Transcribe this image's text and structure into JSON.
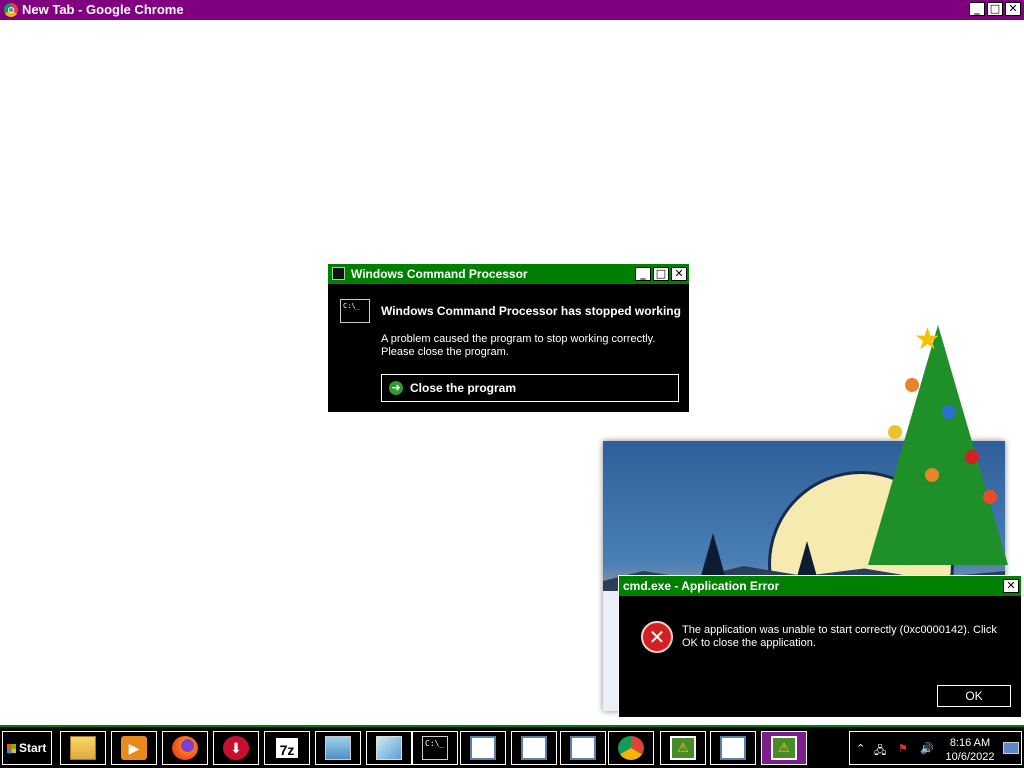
{
  "browser": {
    "title": "New Tab - Google Chrome"
  },
  "window_buttons": {
    "minimize": "_",
    "maximize": "□",
    "close": "✕"
  },
  "dialog_cmd": {
    "title": "Windows Command Processor",
    "icon_text": "C:\\_",
    "headline": "Windows Command Processor has stopped working",
    "message_line1": "A problem caused the program to stop working correctly.",
    "message_line2": "Please close the program.",
    "close_button": "Close the program"
  },
  "dialog_error": {
    "title": "cmd.exe - Application Error",
    "message": "The application was unable to start correctly (0xc0000142). Click OK to close the application.",
    "ok_button": "OK"
  },
  "taskbar": {
    "start_label": "Start",
    "items": [
      {
        "name": "file-explorer-icon"
      },
      {
        "name": "media-player-icon"
      },
      {
        "name": "firefox-icon"
      },
      {
        "name": "download-manager-icon"
      },
      {
        "name": "7zip-icon",
        "label": "7z"
      },
      {
        "name": "notepad-icon"
      },
      {
        "name": "editor-icon"
      },
      {
        "name": "cmd-icon",
        "label": "C:\\_"
      },
      {
        "name": "window-icon"
      },
      {
        "name": "window-icon"
      },
      {
        "name": "window-icon"
      },
      {
        "name": "chrome-icon"
      },
      {
        "name": "warning-window-icon"
      },
      {
        "name": "window-icon"
      },
      {
        "name": "warning-window-icon"
      }
    ]
  },
  "tray": {
    "time": "8:16 AM",
    "date": "10/6/2022"
  },
  "colors": {
    "titlebar": "#800080",
    "dialog_titlebar": "#008000",
    "dialog_bg": "#000000"
  }
}
